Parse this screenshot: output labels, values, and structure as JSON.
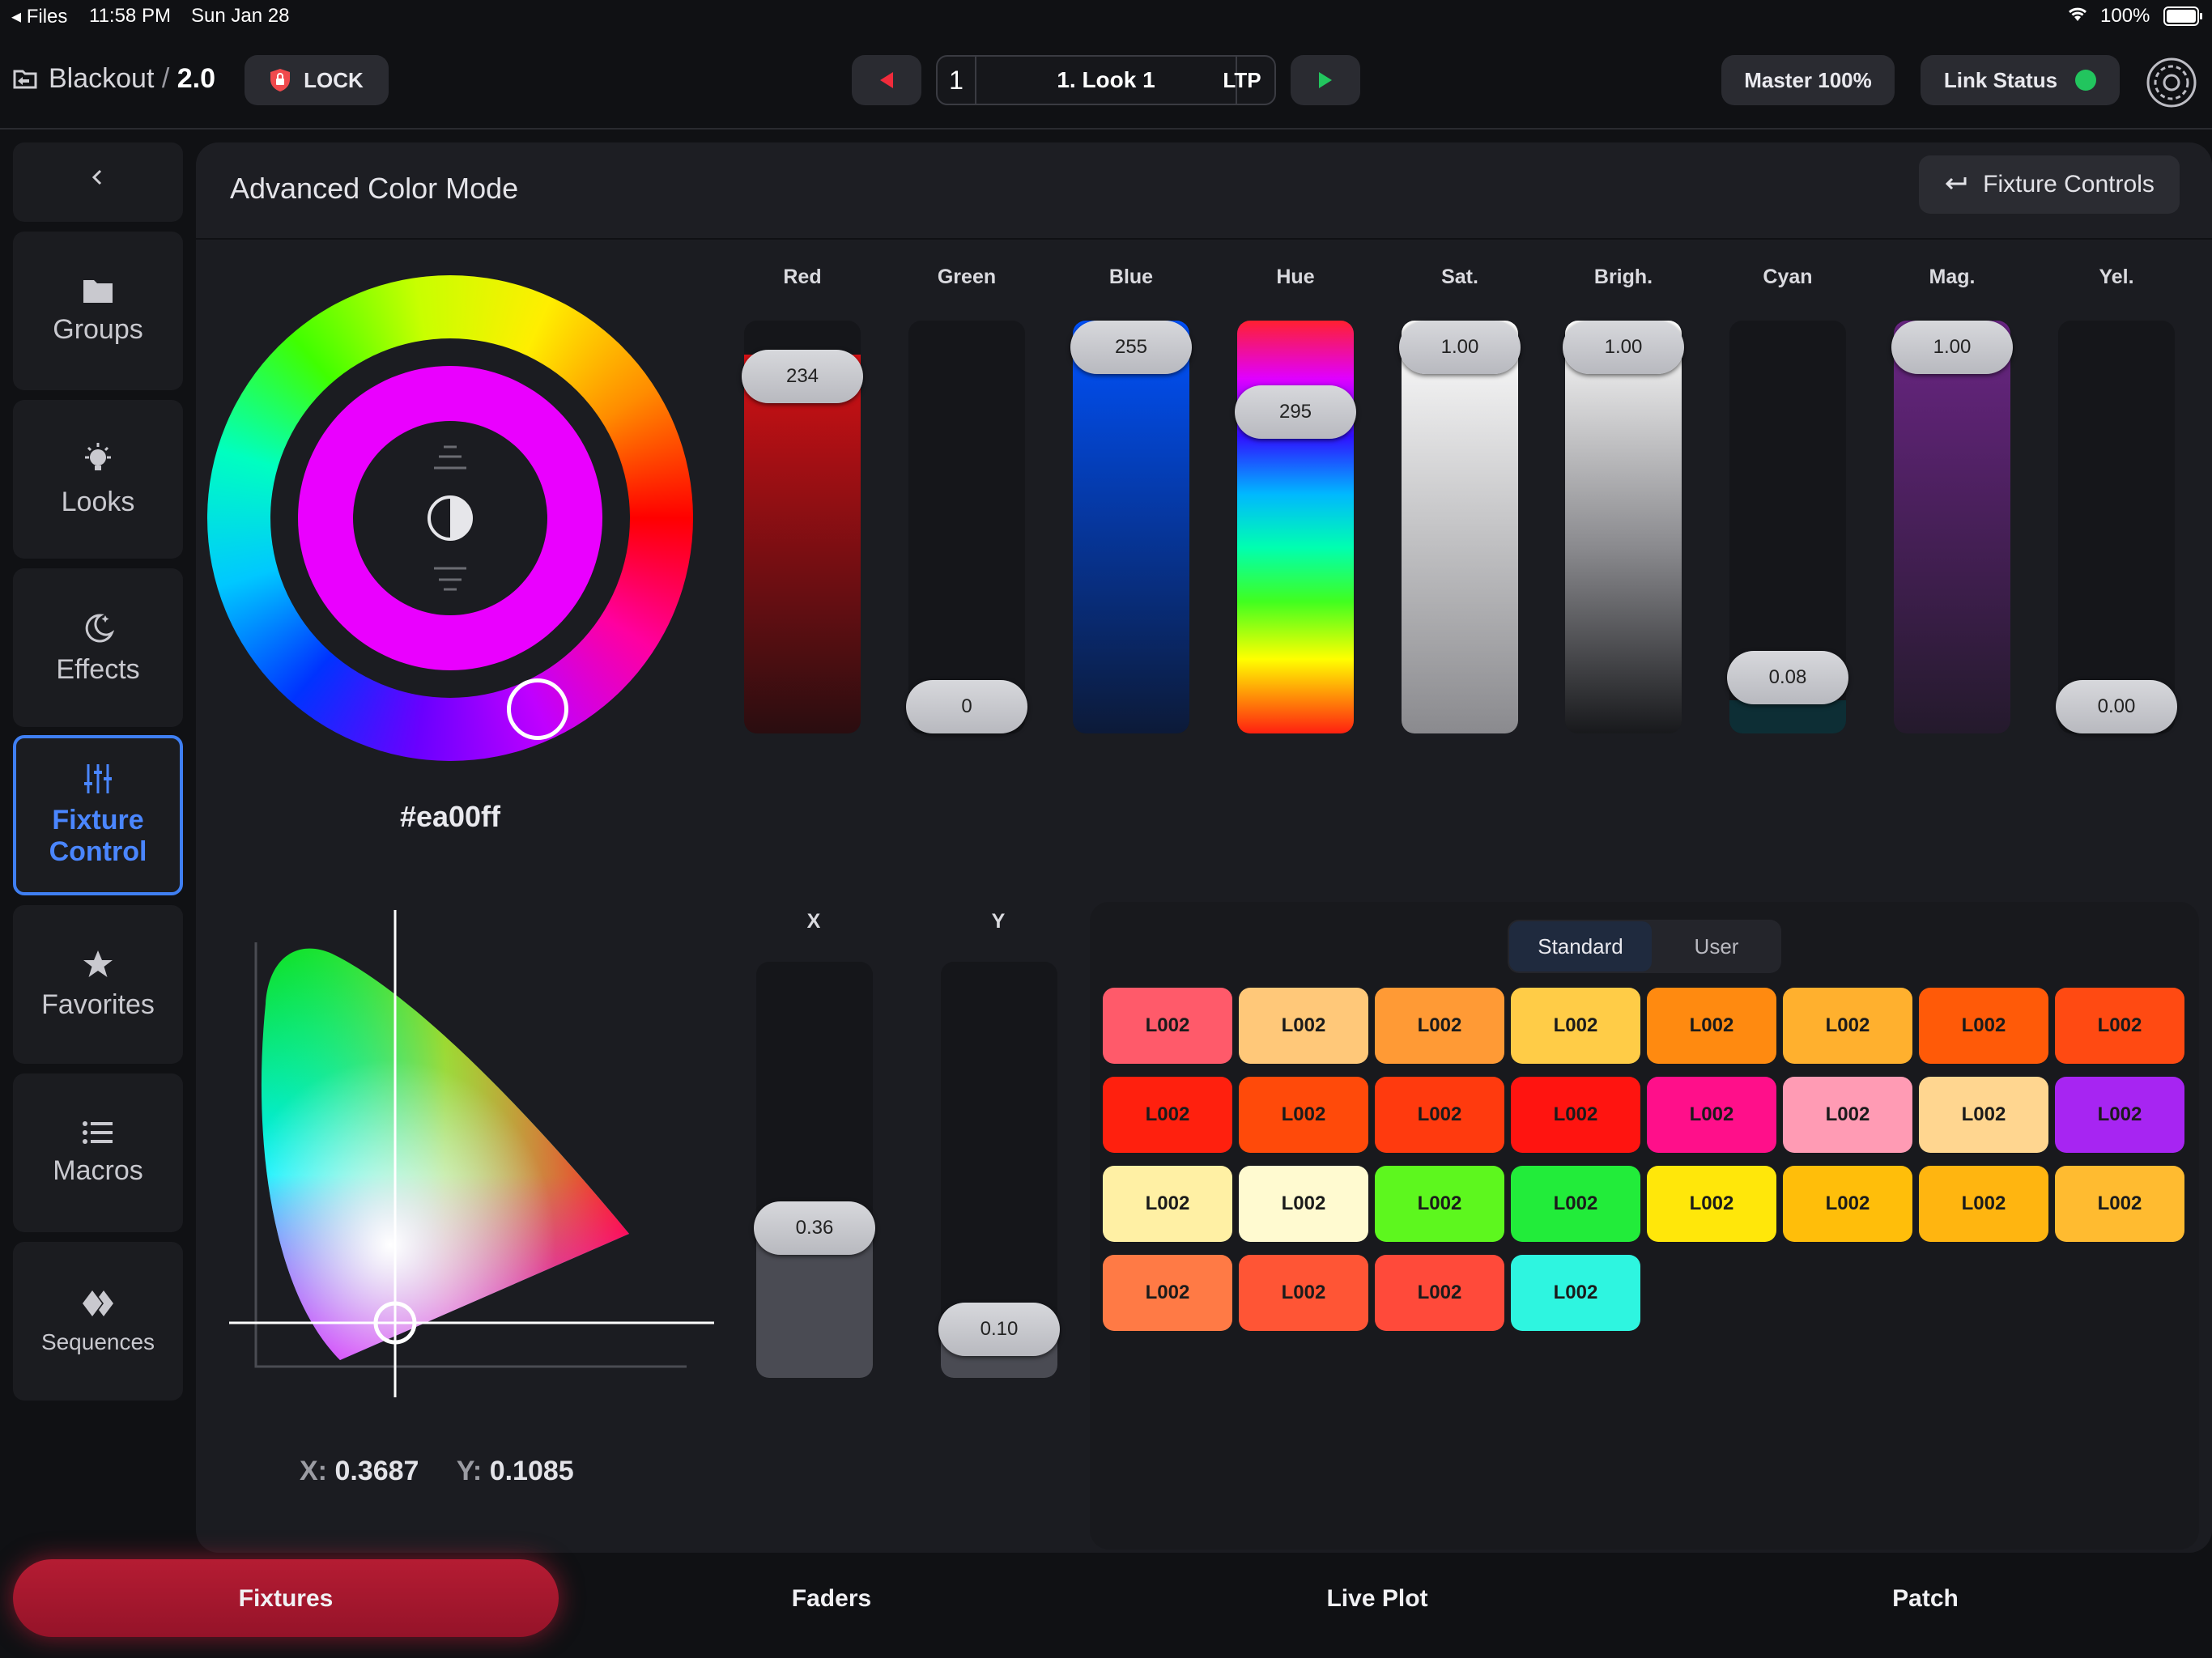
{
  "status_bar": {
    "back_app": "Files",
    "time": "11:58 PM",
    "date": "Sun Jan 28",
    "battery": "100%"
  },
  "header": {
    "title": "Blackout",
    "separator": "/",
    "version": "2.0",
    "lock_label": "LOCK",
    "cue_number": "1",
    "cue_name": "1. Look 1",
    "ltp_label": "LTP",
    "master_label": "Master 100%",
    "link_status_label": "Link Status",
    "link_status_color": "#22c55e"
  },
  "sidebar": {
    "items": [
      {
        "label": "Groups",
        "icon": "folder-icon"
      },
      {
        "label": "Looks",
        "icon": "lightbulb-icon"
      },
      {
        "label": "Effects",
        "icon": "moon-stars-icon"
      },
      {
        "label": "Fixture",
        "label2": "Control",
        "icon": "sliders-icon",
        "active": true
      },
      {
        "label": "Favorites",
        "icon": "star-icon"
      },
      {
        "label": "Macros",
        "icon": "list-icon"
      },
      {
        "label": "Sequences",
        "icon": "diamond-icon"
      }
    ]
  },
  "panel": {
    "title": "Advanced Color Mode",
    "fixture_controls_label": "Fixture Controls",
    "hex_value": "#ea00ff",
    "sliders": [
      {
        "label": "Red",
        "value": "234",
        "level": 0.918
      },
      {
        "label": "Green",
        "value": "0",
        "level": 0.0
      },
      {
        "label": "Blue",
        "value": "255",
        "level": 1.0
      },
      {
        "label": "Hue",
        "value": "295",
        "level": 0.82
      },
      {
        "label": "Sat.",
        "value": "1.00",
        "level": 1.0
      },
      {
        "label": "Brigh.",
        "value": "1.00",
        "level": 1.0
      },
      {
        "label": "Cyan",
        "value": "0.08",
        "level": 0.08
      },
      {
        "label": "Mag.",
        "value": "1.00",
        "level": 1.0
      },
      {
        "label": "Yel.",
        "value": "0.00",
        "level": 0.0
      }
    ],
    "xy_sliders": [
      {
        "label": "X",
        "value": "0.36",
        "level": 0.36
      },
      {
        "label": "Y",
        "value": "0.10",
        "level": 0.1
      }
    ],
    "cie_readout": {
      "x_label": "X:",
      "x_value": "0.3687",
      "y_label": "Y:",
      "y_value": "0.1085"
    },
    "preset_tabs": {
      "standard": "Standard",
      "user": "User"
    },
    "presets": [
      {
        "label": "L002",
        "color": "#ff5a6a"
      },
      {
        "label": "L002",
        "color": "#ffc879"
      },
      {
        "label": "L002",
        "color": "#ff9a35"
      },
      {
        "label": "L002",
        "color": "#ffcc47"
      },
      {
        "label": "L002",
        "color": "#ff8a10"
      },
      {
        "label": "L002",
        "color": "#ffb02e"
      },
      {
        "label": "L002",
        "color": "#ff5a08"
      },
      {
        "label": "L002",
        "color": "#ff4a12"
      },
      {
        "label": "L002",
        "color": "#ff200e"
      },
      {
        "label": "L002",
        "color": "#ff4a0a"
      },
      {
        "label": "L002",
        "color": "#ff3a0e"
      },
      {
        "label": "L002",
        "color": "#ff1410"
      },
      {
        "label": "L002",
        "color": "#ff0f8a"
      },
      {
        "label": "L002",
        "color": "#ff9bb4"
      },
      {
        "label": "L002",
        "color": "#ffd690"
      },
      {
        "label": "L002",
        "color": "#a725f2"
      },
      {
        "label": "L002",
        "color": "#fff0a4"
      },
      {
        "label": "L002",
        "color": "#fffad0"
      },
      {
        "label": "L002",
        "color": "#5df71e"
      },
      {
        "label": "L002",
        "color": "#22ec3a"
      },
      {
        "label": "L002",
        "color": "#ffe70a"
      },
      {
        "label": "L002",
        "color": "#ffbe0a"
      },
      {
        "label": "L002",
        "color": "#ffb510"
      },
      {
        "label": "L002",
        "color": "#ffbb30"
      },
      {
        "label": "L002",
        "color": "#ff7a45"
      },
      {
        "label": "L002",
        "color": "#ff5535"
      },
      {
        "label": "L002",
        "color": "#ff4a3a"
      },
      {
        "label": "L002",
        "color": "#2ef5e0"
      }
    ]
  },
  "bottom_tabs": {
    "fixtures": "Fixtures",
    "faders": "Faders",
    "live_plot": "Live Plot",
    "patch": "Patch"
  }
}
